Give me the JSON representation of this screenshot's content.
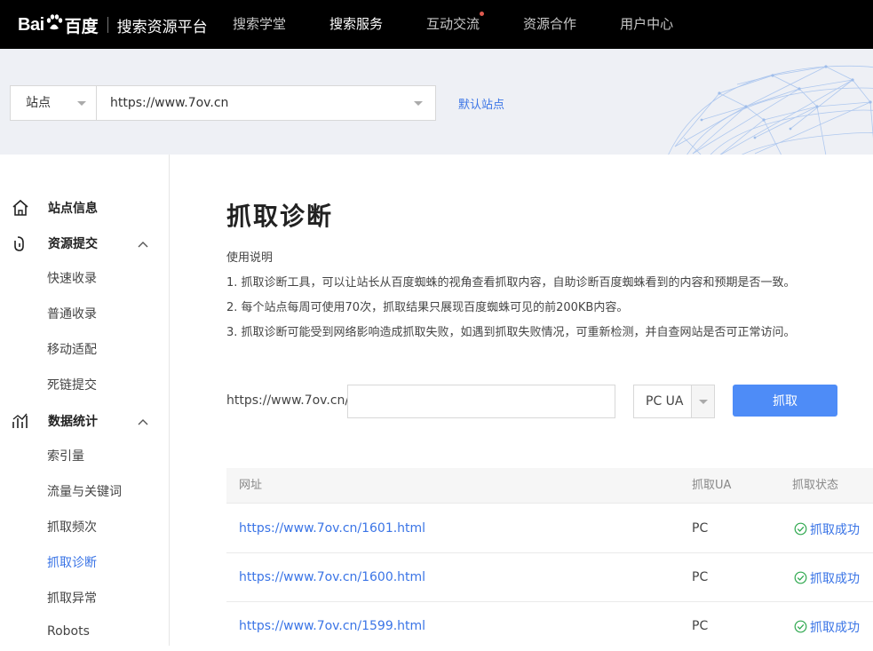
{
  "header": {
    "logo_bai": "Bai",
    "logo_du": "百度",
    "logo_subtitle": "搜索资源平台",
    "nav": [
      {
        "label": "搜索学堂",
        "active": false,
        "dot": false
      },
      {
        "label": "搜索服务",
        "active": true,
        "dot": false
      },
      {
        "label": "互动交流",
        "active": false,
        "dot": true
      },
      {
        "label": "资源合作",
        "active": false,
        "dot": false
      },
      {
        "label": "用户中心",
        "active": false,
        "dot": false
      }
    ]
  },
  "site_bar": {
    "type_label": "站点",
    "site_url": "https://www.7ov.cn",
    "default_site_label": "默认站点"
  },
  "sidebar": {
    "site_info": "站点信息",
    "resource_submit": "资源提交",
    "resource_items": [
      "快速收录",
      "普通收录",
      "移动适配",
      "死链提交"
    ],
    "data_stats": "数据统计",
    "stats_items": [
      "索引量",
      "流量与关键词",
      "抓取频次",
      "抓取诊断",
      "抓取异常",
      "Robots"
    ],
    "active_item": "抓取诊断"
  },
  "main": {
    "title": "抓取诊断",
    "usage_title": "使用说明",
    "usage_lines": [
      "1. 抓取诊断工具，可以让站长从百度蜘蛛的视角查看抓取内容，自助诊断百度蜘蛛看到的内容和预期是否一致。",
      "2. 每个站点每周可使用70次，抓取结果只展现百度蜘蛛可见的前200KB内容。",
      "3. 抓取诊断可能受到网络影响造成抓取失败，如遇到抓取失败情况，可重新检测，并自查网站是否可正常访问。"
    ],
    "crawl_prefix": "https://www.7ov.cn/",
    "crawl_input_value": "",
    "ua_selected": "PC UA",
    "crawl_button": "抓取",
    "table": {
      "headers": [
        "网址",
        "抓取UA",
        "抓取状态"
      ],
      "rows": [
        {
          "url": "https://www.7ov.cn/1601.html",
          "ua": "PC",
          "status": "抓取成功"
        },
        {
          "url": "https://www.7ov.cn/1600.html",
          "ua": "PC",
          "status": "抓取成功"
        },
        {
          "url": "https://www.7ov.cn/1599.html",
          "ua": "PC",
          "status": "抓取成功"
        }
      ]
    }
  },
  "colors": {
    "accent": "#3a74e6",
    "button": "#4e8cf7",
    "success": "#2fa84f",
    "topbar": "#000000"
  }
}
